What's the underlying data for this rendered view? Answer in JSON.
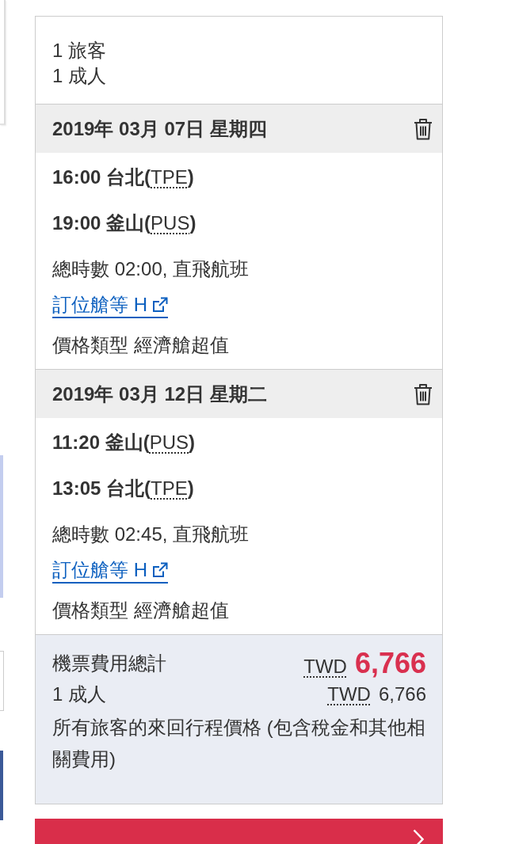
{
  "passengers": {
    "travellers": "1 旅客",
    "adults": "1 成人"
  },
  "flights": [
    {
      "date": "2019年 03月 07日 星期四",
      "departure": {
        "before": "16:00 台北(",
        "code": "TPE",
        "after": ")"
      },
      "arrival": {
        "before": "19:00 釜山(",
        "code": "PUS",
        "after": ")"
      },
      "duration": "總時數 02:00, 直飛航班",
      "booking_class_link": "訂位艙等 H",
      "fare_type": "價格類型 經濟艙超值"
    },
    {
      "date": "2019年 03月 12日 星期二",
      "departure": {
        "before": "11:20 釜山(",
        "code": "PUS",
        "after": ")"
      },
      "arrival": {
        "before": "13:05 台北(",
        "code": "TPE",
        "after": ")"
      },
      "duration": "總時數 02:45, 直飛航班",
      "booking_class_link": "訂位艙等 H",
      "fare_type": "價格類型 經濟艙超值"
    }
  ],
  "price_summary": {
    "total": {
      "label": "機票費用總計",
      "currency": "TWD",
      "amount": "6,766"
    },
    "adult": {
      "label": "1 成人",
      "currency": "TWD",
      "amount": "6,766"
    },
    "note": "所有旅客的來回行程價格 (包含稅金和其他相關費用)"
  }
}
